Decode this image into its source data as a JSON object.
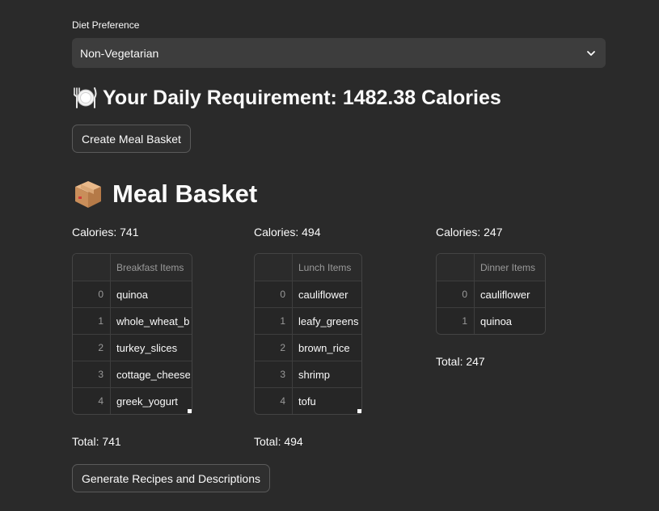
{
  "diet": {
    "label": "Diet Preference",
    "selected": "Non-Vegetarian"
  },
  "requirement": {
    "text": "Your Daily Requirement: 1482.38 Calories",
    "icon": "plate-cutlery-icon"
  },
  "buttons": {
    "create_label": "Create Meal Basket",
    "generate_label": "Generate Recipes and Descriptions"
  },
  "basket": {
    "title": "Meal Basket",
    "icon": "package-box-icon"
  },
  "meals": [
    {
      "calories": "Calories: 741",
      "header": "Breakfast Items",
      "items": [
        {
          "index": "0",
          "name": "quinoa"
        },
        {
          "index": "1",
          "name": "whole_wheat_b"
        },
        {
          "index": "2",
          "name": "turkey_slices"
        },
        {
          "index": "3",
          "name": "cottage_cheese"
        },
        {
          "index": "4",
          "name": "greek_yogurt"
        }
      ],
      "total": "Total: 741"
    },
    {
      "calories": "Calories: 494",
      "header": "Lunch Items",
      "items": [
        {
          "index": "0",
          "name": "cauliflower"
        },
        {
          "index": "1",
          "name": "leafy_greens"
        },
        {
          "index": "2",
          "name": "brown_rice"
        },
        {
          "index": "3",
          "name": "shrimp"
        },
        {
          "index": "4",
          "name": "tofu"
        }
      ],
      "total": "Total: 494"
    },
    {
      "calories": "Calories: 247",
      "header": "Dinner Items",
      "items": [
        {
          "index": "0",
          "name": "cauliflower"
        },
        {
          "index": "1",
          "name": "quinoa"
        }
      ],
      "total": "Total: 247"
    }
  ]
}
